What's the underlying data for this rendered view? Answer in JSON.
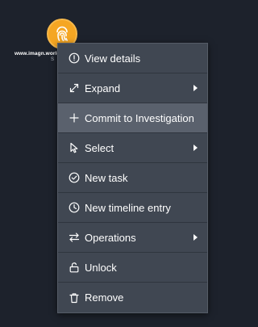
{
  "node": {
    "label": "www.imagn.world",
    "sublabel": "S",
    "icon": "fingerprint-icon",
    "color": "#f5a623"
  },
  "menu": {
    "items": [
      {
        "label": "View details",
        "icon": "info-circle-icon",
        "submenu": false
      },
      {
        "label": "Expand",
        "icon": "expand-arrows-icon",
        "submenu": true
      },
      {
        "label": "Commit to Investigation",
        "icon": "plus-icon",
        "submenu": false,
        "active": true
      },
      {
        "label": "Select",
        "icon": "pointer-icon",
        "submenu": true
      },
      {
        "label": "New task",
        "icon": "check-circle-icon",
        "submenu": false
      },
      {
        "label": "New timeline entry",
        "icon": "clock-icon",
        "submenu": false
      },
      {
        "label": "Operations",
        "icon": "swap-arrows-icon",
        "submenu": true
      },
      {
        "label": "Unlock",
        "icon": "unlock-icon",
        "submenu": false
      },
      {
        "label": "Remove",
        "icon": "trash-icon",
        "submenu": false
      }
    ]
  },
  "colors": {
    "background": "#1d222c",
    "menu_background": "#404752",
    "menu_active": "#5a616d",
    "text": "#ffffff"
  }
}
